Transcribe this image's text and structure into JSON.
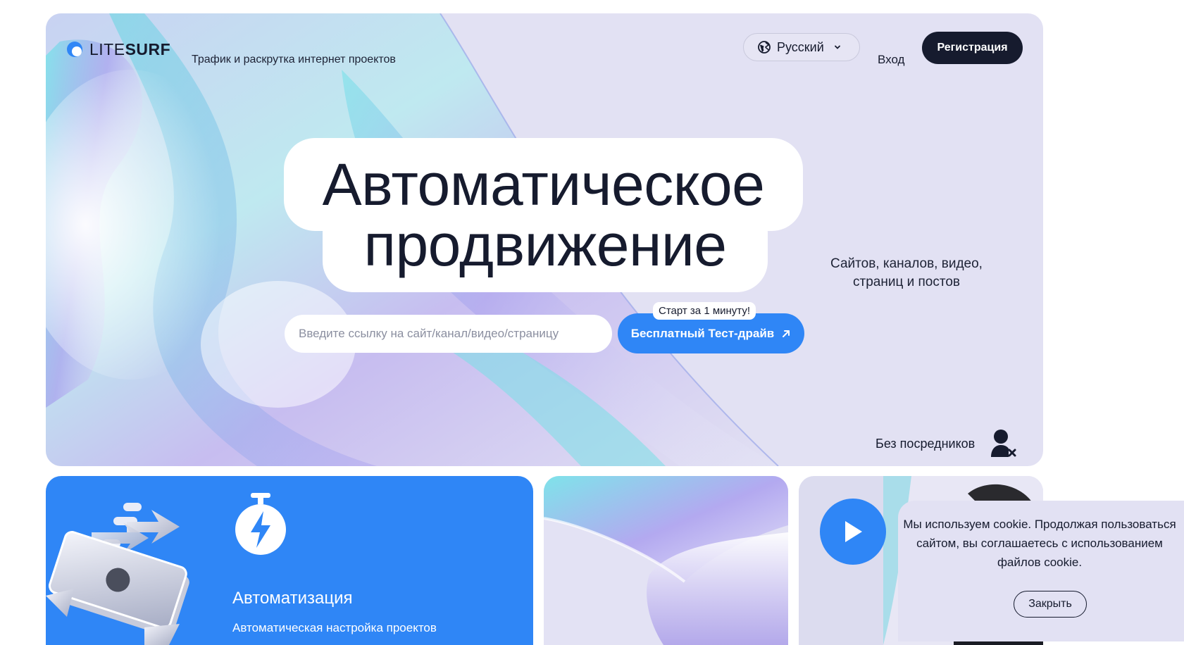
{
  "header": {
    "brand_light": "LITE",
    "brand_bold": "SURF",
    "tagline": "Трафик и раскрутка интернет проектов",
    "language": "Русский",
    "login": "Вход",
    "register": "Регистрация"
  },
  "hero": {
    "title_line1": "Автоматическое",
    "title_line2": "продвижение",
    "subtitle": "Сайтов, каналов, видео, страниц и постов",
    "url_placeholder": "Введите ссылку на сайт/канал/видео/страницу",
    "cta_label": "Бесплатный Тест-драйв",
    "cta_badge": "Старт за 1 минуту!",
    "no_middlemen": "Без посредников"
  },
  "features": {
    "automation_title": "Автоматизация",
    "automation_desc": "Автоматическая настройка проектов"
  },
  "cookie": {
    "text": "Мы используем cookie. Продолжая пользоваться сайтом, вы соглашаетесь с использованием файлов cookie.",
    "close": "Закрыть"
  },
  "colors": {
    "accent": "#2f86f6",
    "dark": "#161b2e",
    "hero_bg": "#e2e1f3"
  },
  "icons": [
    "litesurf-logo-icon",
    "globe-icon",
    "chevron-down-icon",
    "arrow-up-right-icon",
    "user-x-icon",
    "stopwatch-bolt-icon",
    "play-icon"
  ]
}
